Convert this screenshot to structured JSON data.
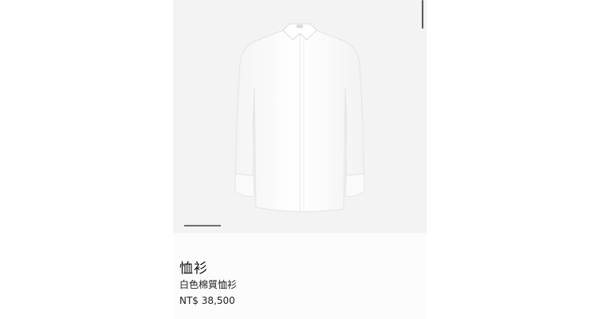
{
  "product": {
    "category_title": "恤衫",
    "name": "白色棉質恤衫",
    "price": "NT$ 38,500",
    "image_icon": "white-shirt-icon"
  },
  "carousel": {
    "active_index": 1,
    "total": 1
  },
  "colors": {
    "image_background": "#f3f3f3",
    "info_background": "#fcfcfc",
    "text": "#111111"
  }
}
